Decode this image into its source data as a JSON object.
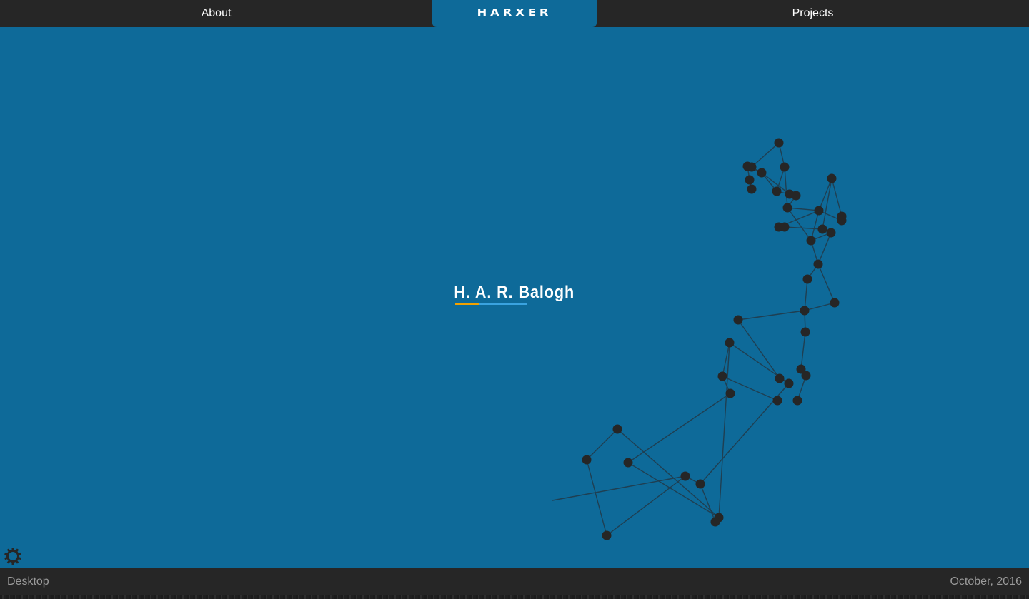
{
  "nav": {
    "about_label": "About",
    "logo_text": "HARXER",
    "projects_label": "Projects"
  },
  "main": {
    "name": "H. A. R. Balogh"
  },
  "settings": {
    "icon": "gear-icon"
  },
  "footer": {
    "left_text": "Desktop",
    "right_text": "October, 2016"
  },
  "colors": {
    "background": "#0e6a99",
    "bar": "#262626",
    "node": "#262626",
    "underline_orange": "#f2a100",
    "underline_blue": "#3aa3e0"
  }
}
